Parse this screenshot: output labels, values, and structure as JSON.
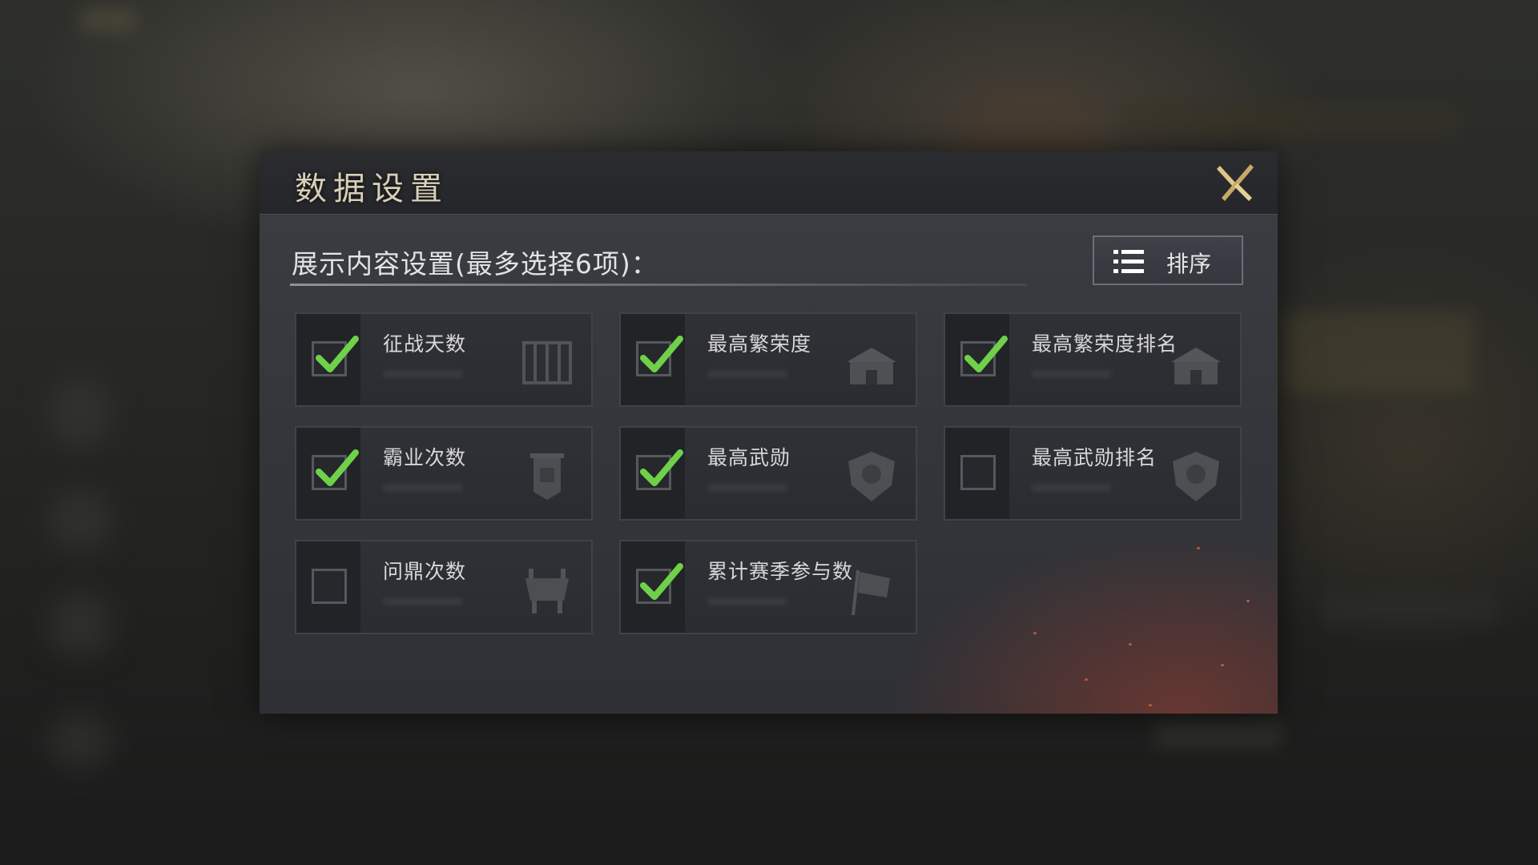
{
  "dialog": {
    "title": "数据设置",
    "close_icon": "close-x-icon",
    "section_label": "展示内容设置(最多选择6项)：",
    "sort_button": {
      "label": "排序",
      "icon": "list-icon"
    }
  },
  "options": [
    {
      "label": "征战天数",
      "checked": true,
      "icon": "book-icon"
    },
    {
      "label": "最高繁荣度",
      "checked": true,
      "icon": "city-gate-icon"
    },
    {
      "label": "最高繁荣度排名",
      "checked": true,
      "icon": "city-gate-icon"
    },
    {
      "label": "霸业次数",
      "checked": true,
      "icon": "banner-icon"
    },
    {
      "label": "最高武勋",
      "checked": true,
      "icon": "dragon-shield-icon"
    },
    {
      "label": "最高武勋排名",
      "checked": false,
      "icon": "dragon-shield-icon"
    },
    {
      "label": "问鼎次数",
      "checked": false,
      "icon": "cauldron-icon"
    },
    {
      "label": "累计赛季参与数",
      "checked": true,
      "icon": "flag-icon"
    }
  ],
  "colors": {
    "check_green": "#6fd14a",
    "title_gold": "#d8cfb8",
    "close_gold": "#c9a867"
  }
}
